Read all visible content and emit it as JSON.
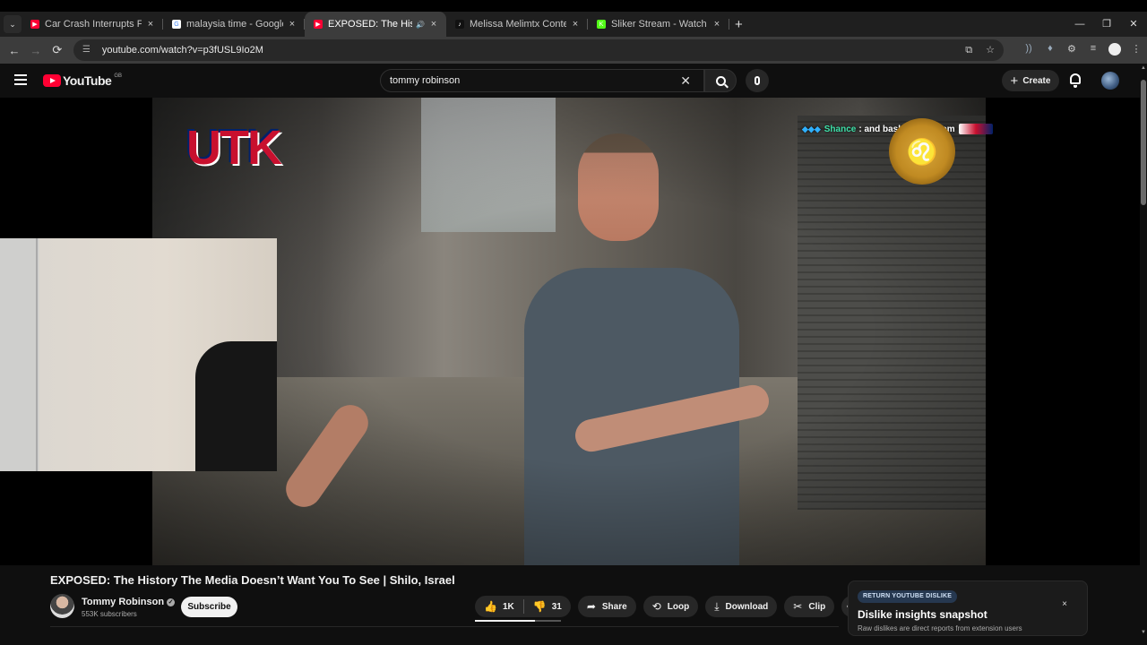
{
  "browser": {
    "tabs": [
      {
        "title": "Car Crash Interrupts Food Revie",
        "favicon_color": "#ff0033",
        "favicon": "▶",
        "active": false
      },
      {
        "title": "malaysia time - Google Search",
        "favicon_color": "#ffffff",
        "favicon": "G",
        "active": false
      },
      {
        "title": "EXPOSED: The History The",
        "favicon_color": "#ff0033",
        "favicon": "▶",
        "active": true
      },
      {
        "title": "Melissa Melimtx Content Overvi",
        "favicon_color": "#111111",
        "favicon": "♪",
        "active": false
      },
      {
        "title": "Sliker Stream - Watch Live on K",
        "favicon_color": "#53fc18",
        "favicon": "K",
        "active": false
      }
    ],
    "new_tab": "+",
    "tab_close": "×",
    "tab_list": "⌄",
    "window": {
      "minimize": "—",
      "restore": "❐",
      "close": "✕"
    },
    "nav": {
      "back": "←",
      "forward": "→",
      "reload": "⟳"
    },
    "url": "youtube.com/watch?v=p3fUSL9Io2M"
  },
  "youtube": {
    "logo_text": "YouTube",
    "country_code": "GB",
    "search_query": "tommy robinson",
    "clear_search": "✕",
    "create_label": "Create",
    "create_plus": "+"
  },
  "video": {
    "overlay_logo_text": "UTK",
    "chat_user": "Shance",
    "chat_message": ": and bashar rule them",
    "lion_glyph": "♌"
  },
  "info": {
    "title": "EXPOSED: The History The Media Doesn’t Want You To See | Shilo, Israel",
    "channel_name": "Tommy Robinson",
    "verified": "✓",
    "subscribers": "553K subscribers",
    "subscribe_label": "Subscribe",
    "likes": "1K",
    "dislikes": "31",
    "like_ratio": 0.7,
    "actions": {
      "share": "Share",
      "loop": "Loop",
      "download": "Download",
      "clip": "Clip",
      "more": "•••"
    },
    "icons": {
      "like": "👍",
      "dislike": "👎",
      "share": "➦",
      "loop": "⟲",
      "download": "⤓",
      "clip": "✂"
    }
  },
  "ryd_card": {
    "badge": "RETURN YOUTUBE DISLIKE",
    "title": "Dislike insights snapshot",
    "subtitle": "Raw dislikes are direct reports from extension users",
    "close": "×"
  }
}
